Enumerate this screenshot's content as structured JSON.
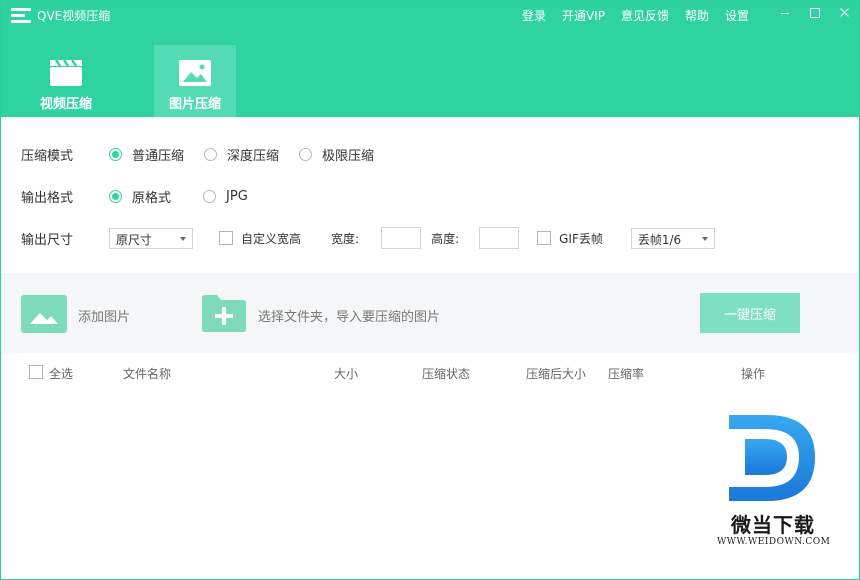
{
  "app": {
    "title": "QVE视频压缩"
  },
  "top_menu": [
    "登录",
    "开通VIP",
    "意见反馈",
    "帮助",
    "设置"
  ],
  "tabs": [
    {
      "label": "视频压缩",
      "icon": "video-clapper-icon",
      "active": false
    },
    {
      "label": "图片压缩",
      "icon": "image-icon",
      "active": true
    }
  ],
  "settings": {
    "mode": {
      "label": "压缩模式",
      "options": [
        "普通压缩",
        "深度压缩",
        "极限压缩"
      ],
      "selected": "普通压缩"
    },
    "format": {
      "label": "输出格式",
      "options": [
        "原格式",
        "JPG"
      ],
      "selected": "原格式"
    },
    "size": {
      "label": "输出尺寸",
      "select_value": "原尺寸",
      "custom_label": "自定义宽高",
      "width_label": "宽度:",
      "height_label": "高度:",
      "width_value": "",
      "height_value": "",
      "gif_label": "GIF丢帧",
      "gif_select_value": "丢帧1/6"
    }
  },
  "actions": {
    "add_image": "添加图片",
    "choose_folder": "选择文件夹，导入要压缩的图片",
    "compress_all": "一键压缩"
  },
  "table": {
    "select_all": "全选",
    "columns": [
      "文件名称",
      "大小",
      "压缩状态",
      "压缩后大小",
      "压缩率",
      "操作"
    ]
  },
  "watermark": {
    "name": "微当下载",
    "url": "WWW.WEIDOWN.COM"
  },
  "colors": {
    "accent": "#2fd3a0",
    "tab_active": "#53dcb3",
    "button": "#7fdfc1"
  }
}
